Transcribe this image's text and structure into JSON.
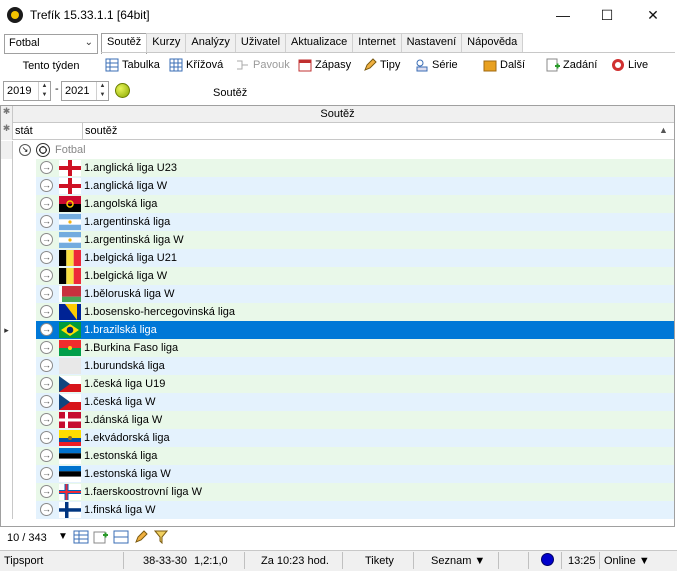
{
  "window": {
    "title": "Trefík 15.33.1.1 [64bit]"
  },
  "sport_select": {
    "value": "Fotbal"
  },
  "week_label": "Tento týden",
  "tabs": [
    "Soutěž",
    "Kurzy",
    "Analýzy",
    "Uživatel",
    "Aktualizace",
    "Internet",
    "Nastavení",
    "Nápověda"
  ],
  "toolbar": {
    "tabulka": "Tabulka",
    "krizova": "Křížová",
    "pavouk": "Pavouk",
    "zapasy": "Zápasy",
    "tipy": "Tipy",
    "serie": "Série",
    "dalsi": "Další",
    "zadani": "Zadání",
    "live": "Live"
  },
  "years": {
    "from": "2019",
    "to": "2021",
    "separator": "-"
  },
  "competition_caption": "Soutěž",
  "grid": {
    "band_header": "Soutěž",
    "col_stat": "stát",
    "col_soutez": "soutěž",
    "group_label": "Fotbal",
    "rows": [
      {
        "name": "1.anglická liga U23",
        "flag": "england"
      },
      {
        "name": "1.anglická liga W",
        "flag": "england"
      },
      {
        "name": "1.angolská liga",
        "flag": "angola"
      },
      {
        "name": "1.argentinská liga",
        "flag": "argentina"
      },
      {
        "name": "1.argentinská liga W",
        "flag": "argentina"
      },
      {
        "name": "1.belgická liga U21",
        "flag": "belgium"
      },
      {
        "name": "1.belgická liga W",
        "flag": "belgium"
      },
      {
        "name": "1.běloruská liga W",
        "flag": "belarus"
      },
      {
        "name": "1.bosensko-hercegovinská liga",
        "flag": "bosnia"
      },
      {
        "name": "1.brazilská liga",
        "flag": "brazil"
      },
      {
        "name": "1.Burkina Faso liga",
        "flag": "burkina"
      },
      {
        "name": "1.burundská liga",
        "flag": "burundi"
      },
      {
        "name": "1.česká liga U19",
        "flag": "czech"
      },
      {
        "name": "1.česká liga W",
        "flag": "czech"
      },
      {
        "name": "1.dánská liga W",
        "flag": "denmark"
      },
      {
        "name": "1.ekvádorská liga",
        "flag": "ecuador"
      },
      {
        "name": "1.estonská liga",
        "flag": "estonia"
      },
      {
        "name": "1.estonská liga W",
        "flag": "estonia"
      },
      {
        "name": "1.faerskoostrovní liga W",
        "flag": "faroe"
      },
      {
        "name": "1.finská liga W",
        "flag": "finland"
      }
    ],
    "selected_index": 9
  },
  "record_counter": "10 / 343",
  "statusbar": {
    "bookmaker": "Tipsport",
    "score": "38-33-30",
    "ratio": "1,2:1,0",
    "until": "Za 10:23 hod.",
    "tikety": "Tikety",
    "seznam": "Seznam ▼",
    "time": "13:25",
    "online": "Online ▼"
  },
  "colors": {
    "selected_row": "#0078d7",
    "row_green": "#e9f8e9",
    "row_blue": "#e4f2fd",
    "status_dot": "#0000cc"
  }
}
